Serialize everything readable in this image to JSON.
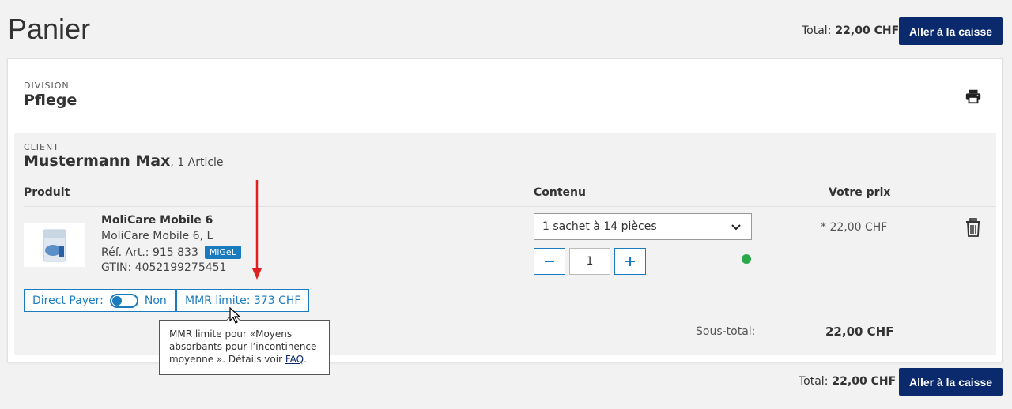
{
  "page": {
    "title": "Panier"
  },
  "header": {
    "total_label": "Total:",
    "total_value": "22,00 CHF",
    "checkout_label": "Aller à la caisse"
  },
  "footer": {
    "total_label": "Total:",
    "total_value": "22,00 CHF",
    "checkout_label": "Aller à la caisse"
  },
  "division": {
    "label": "DIVISION",
    "value": "Pflege"
  },
  "client": {
    "label": "CLIENT",
    "name": "Mustermann Max",
    "count": ", 1 Article"
  },
  "columns": {
    "product": "Produit",
    "content": "Contenu",
    "price": "Votre prix"
  },
  "product": {
    "name": "MoliCare Mobile 6",
    "subtitle": "MoliCare Mobile 6, L",
    "ref": "Réf. Art.: 915 833",
    "badge": "MiGeL",
    "gtin": "GTIN: 4052199275451",
    "content_selected": "1 sachet à 14 pièces",
    "quantity": "1",
    "price": "* 22,00 CHF",
    "stock_color": "#2aa84a"
  },
  "direct_payer": {
    "label": "Direct Payer:",
    "state": "Non"
  },
  "mmr": {
    "label": "MMR limite: 373 CHF"
  },
  "tooltip": {
    "text": "MMR limite pour «Moyens absorbants pour l’incontinence moyenne ». Détails voir ",
    "link": "FAQ",
    "end": "."
  },
  "subtotal": {
    "label": "Sous-total:",
    "value": "22,00 CHF"
  },
  "colors": {
    "brand": "#0b2a6e",
    "accent": "#1a7bbf",
    "annotation": "#e02020"
  },
  "icons": {
    "print": "printer-icon",
    "delete": "trash-icon",
    "dropdown": "chevron-down-icon",
    "minus": "minus-icon",
    "plus": "plus-icon"
  }
}
